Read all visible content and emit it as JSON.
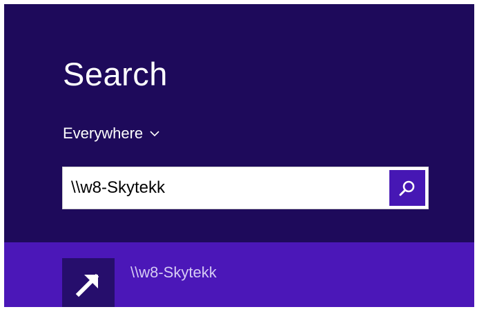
{
  "search": {
    "title": "Search",
    "scope_label": "Everywhere",
    "query_value": "\\\\w8-Skytekk"
  },
  "results": [
    {
      "label": "\\\\w8-Skytekk",
      "icon": "arrow-up-right-icon"
    }
  ],
  "colors": {
    "pane_bg": "#1e0a5b",
    "accent": "#4617b4",
    "result_bg": "#4b17b8",
    "tile_bg": "#260e6c"
  }
}
